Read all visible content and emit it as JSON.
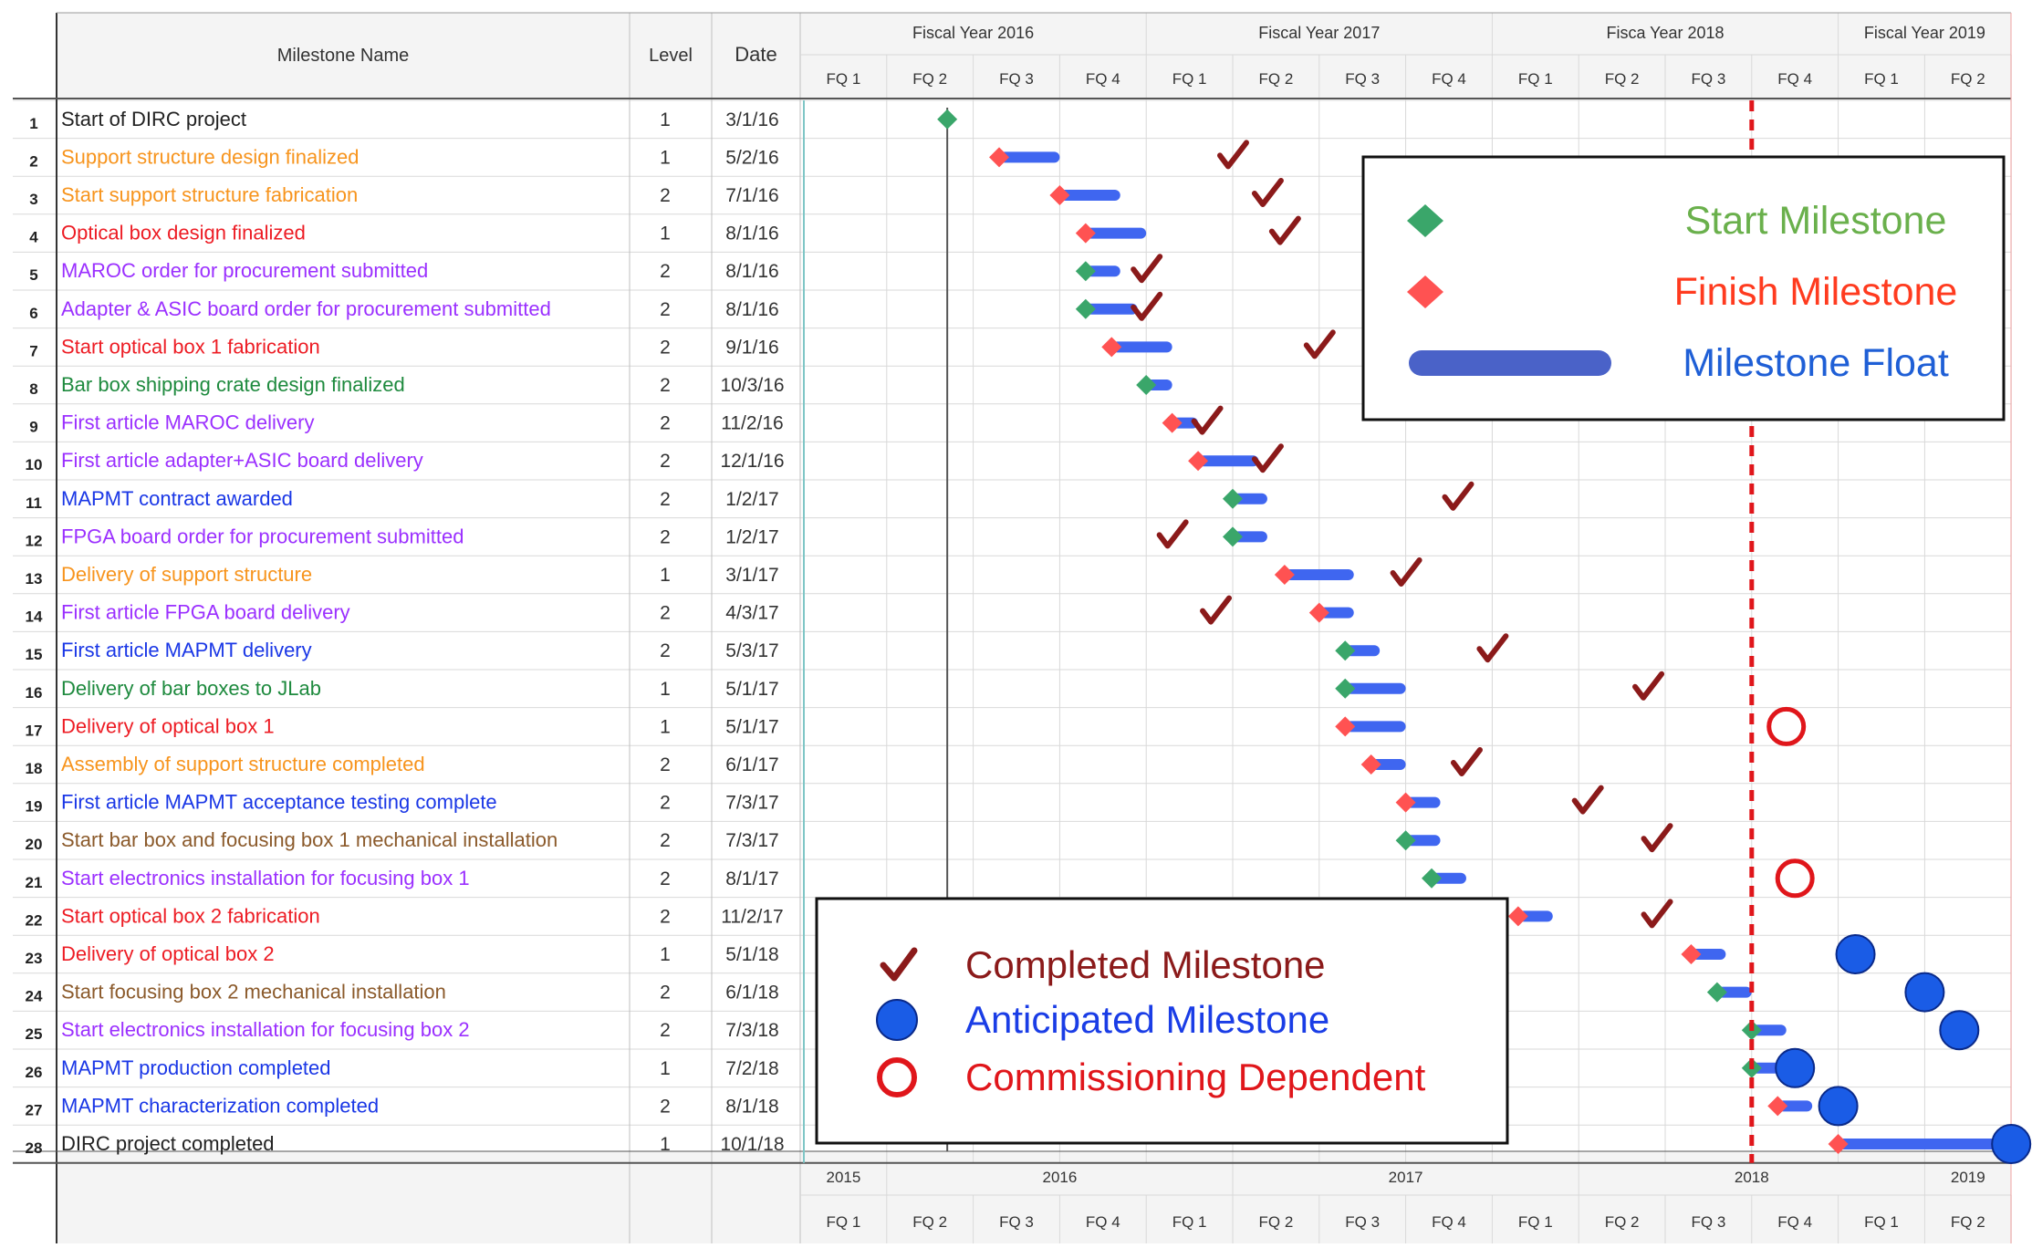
{
  "chart_data": {
    "type": "gantt",
    "columns": {
      "number": "",
      "name": "Milestone Name",
      "level": "Level",
      "date": "Date"
    },
    "fiscal_years": [
      "Fiscal Year 2016",
      "Fiscal Year 2017",
      "Fisca Year 2018",
      "Fiscal Year 2019"
    ],
    "quarters": [
      "FQ 1",
      "FQ 2",
      "FQ 3",
      "FQ 4",
      "FQ 1",
      "FQ 2",
      "FQ 3",
      "FQ 4",
      "FQ 1",
      "FQ 2",
      "FQ 3",
      "FQ 4",
      "FQ 1",
      "FQ 2"
    ],
    "footer_years": [
      "2015",
      "2016",
      "2017",
      "2018",
      "2019"
    ],
    "footer_quarters": [
      "FQ 1",
      "FQ 2",
      "FQ 3",
      "FQ 4",
      "FQ 1",
      "FQ 2",
      "FQ 3",
      "FQ 4",
      "FQ 1",
      "FQ 2",
      "FQ 3",
      "FQ 4",
      "FQ 1",
      "FQ 2"
    ],
    "axis_start_quarter_index": 0,
    "today_line_quarter": 11.0,
    "project_start_line_quarter": 1.7,
    "milestones": [
      {
        "num": "1",
        "name": "Start of DIRC project",
        "level": "1",
        "date": "3/1/16",
        "color": "#222222",
        "start_q": 1.7,
        "float_q": 0.0,
        "status_q": null,
        "status": "none"
      },
      {
        "num": "2",
        "name": "Support structure design finalized",
        "level": "1",
        "date": "5/2/16",
        "color": "#f7941d",
        "start_q": 2.3,
        "float_q": 0.7,
        "status_q": 5.0,
        "status": "completed"
      },
      {
        "num": "3",
        "name": "Start support structure fabrication",
        "level": "2",
        "date": "7/1/16",
        "color": "#f7941d",
        "start_q": 3.0,
        "float_q": 0.7,
        "status_q": 5.4,
        "status": "completed"
      },
      {
        "num": "4",
        "name": "Optical box design finalized",
        "level": "1",
        "date": "8/1/16",
        "color": "#ed1c24",
        "start_q": 3.3,
        "float_q": 0.7,
        "status_q": 5.6,
        "status": "completed"
      },
      {
        "num": "5",
        "name": "MAROC order for procurement submitted",
        "level": "2",
        "date": "8/1/16",
        "color": "#9b30ff",
        "start_q": 3.3,
        "float_q": 0.4,
        "status_q": 4.0,
        "status": "completed"
      },
      {
        "num": "6",
        "name": "Adapter & ASIC board order for procurement submitted",
        "level": "2",
        "date": "8/1/16",
        "color": "#9b30ff",
        "start_q": 3.3,
        "float_q": 0.6,
        "status_q": 4.0,
        "status": "completed"
      },
      {
        "num": "7",
        "name": "Start optical box 1 fabrication",
        "level": "2",
        "date": "9/1/16",
        "color": "#ed1c24",
        "start_q": 3.6,
        "float_q": 0.7,
        "status_q": 6.0,
        "status": "completed"
      },
      {
        "num": "8",
        "name": "Bar box shipping crate design finalized",
        "level": "2",
        "date": "10/3/16",
        "color": "#1e8a3e",
        "start_q": 4.0,
        "float_q": 0.3,
        "status_q": null,
        "status": "none"
      },
      {
        "num": "9",
        "name": "First article MAROC delivery",
        "level": "2",
        "date": "11/2/16",
        "color": "#9b30ff",
        "start_q": 4.3,
        "float_q": 0.3,
        "status_q": 4.7,
        "status": "completed"
      },
      {
        "num": "10",
        "name": "First article adapter+ASIC board delivery",
        "level": "2",
        "date": "12/1/16",
        "color": "#9b30ff",
        "start_q": 4.6,
        "float_q": 0.7,
        "status_q": 5.4,
        "status": "completed"
      },
      {
        "num": "11",
        "name": "MAPMT contract awarded",
        "level": "2",
        "date": "1/2/17",
        "color": "#1a37e6",
        "start_q": 5.0,
        "float_q": 0.4,
        "status_q": 7.6,
        "status": "completed"
      },
      {
        "num": "12",
        "name": "FPGA board order for procurement submitted",
        "level": "2",
        "date": "1/2/17",
        "color": "#9b30ff",
        "start_q": 5.0,
        "float_q": 0.4,
        "status_q": 4.3,
        "status": "completed"
      },
      {
        "num": "13",
        "name": "Delivery of support structure",
        "level": "1",
        "date": "3/1/17",
        "color": "#f7941d",
        "start_q": 5.6,
        "float_q": 0.8,
        "status_q": 7.0,
        "status": "completed"
      },
      {
        "num": "14",
        "name": "First article FPGA board delivery",
        "level": "2",
        "date": "4/3/17",
        "color": "#9b30ff",
        "start_q": 6.0,
        "float_q": 0.4,
        "status_q": 4.8,
        "status": "completed"
      },
      {
        "num": "15",
        "name": "First article MAPMT delivery",
        "level": "2",
        "date": "5/3/17",
        "color": "#1a37e6",
        "start_q": 6.3,
        "float_q": 0.4,
        "status_q": 8.0,
        "status": "completed"
      },
      {
        "num": "16",
        "name": "Delivery of bar boxes to JLab",
        "level": "1",
        "date": "5/1/17",
        "color": "#1e8a3e",
        "start_q": 6.3,
        "float_q": 0.7,
        "status_q": 9.8,
        "status": "completed"
      },
      {
        "num": "17",
        "name": "Delivery of optical box 1",
        "level": "1",
        "date": "5/1/17",
        "color": "#ed1c24",
        "start_q": 6.3,
        "float_q": 0.7,
        "status_q": 11.4,
        "status": "commissioning"
      },
      {
        "num": "18",
        "name": "Assembly of support structure completed",
        "level": "2",
        "date": "6/1/17",
        "color": "#f7941d",
        "start_q": 6.6,
        "float_q": 0.4,
        "status_q": 7.7,
        "status": "completed"
      },
      {
        "num": "19",
        "name": "First article MAPMT acceptance testing complete",
        "level": "2",
        "date": "7/3/17",
        "color": "#1a37e6",
        "start_q": 7.0,
        "float_q": 0.4,
        "status_q": 9.1,
        "status": "completed"
      },
      {
        "num": "20",
        "name": "Start bar box and focusing box 1 mechanical installation",
        "level": "2",
        "date": "7/3/17",
        "color": "#8b5a2b",
        "start_q": 7.0,
        "float_q": 0.4,
        "status_q": 9.9,
        "status": "completed"
      },
      {
        "num": "21",
        "name": "Start electronics installation for focusing box 1",
        "level": "2",
        "date": "8/1/17",
        "color": "#9b30ff",
        "start_q": 7.3,
        "float_q": 0.4,
        "status_q": 11.5,
        "status": "commissioning"
      },
      {
        "num": "22",
        "name": "Start optical box 2 fabrication",
        "level": "2",
        "date": "11/2/17",
        "color": "#ed1c24",
        "start_q": 8.3,
        "float_q": 0.4,
        "status_q": 9.9,
        "status": "completed"
      },
      {
        "num": "23",
        "name": "Delivery of optical box 2",
        "level": "1",
        "date": "5/1/18",
        "color": "#ed1c24",
        "start_q": 10.3,
        "float_q": 0.4,
        "status_q": 12.2,
        "status": "anticipated"
      },
      {
        "num": "24",
        "name": "Start focusing box 2 mechanical installation",
        "level": "2",
        "date": "6/1/18",
        "color": "#8b5a2b",
        "start_q": 10.6,
        "float_q": 0.4,
        "status_q": 13.0,
        "status": "anticipated"
      },
      {
        "num": "25",
        "name": "Start electronics installation for focusing box 2",
        "level": "2",
        "date": "7/3/18",
        "color": "#9b30ff",
        "start_q": 11.0,
        "float_q": 0.4,
        "status_q": 13.4,
        "status": "anticipated"
      },
      {
        "num": "26",
        "name": "MAPMT production completed",
        "level": "1",
        "date": "7/2/18",
        "color": "#1a37e6",
        "start_q": 11.0,
        "float_q": 0.4,
        "status_q": 11.5,
        "status": "anticipated"
      },
      {
        "num": "27",
        "name": "MAPMT characterization completed",
        "level": "2",
        "date": "8/1/18",
        "color": "#1a37e6",
        "start_q": 11.3,
        "float_q": 0.4,
        "status_q": 12.0,
        "status": "anticipated"
      },
      {
        "num": "28",
        "name": "DIRC project completed",
        "level": "1",
        "date": "10/1/18",
        "color": "#222222",
        "start_q": 12.0,
        "float_q": 2.0,
        "status_q": 14.0,
        "status": "anticipated"
      }
    ],
    "legend_top": [
      {
        "label": "Start Milestone",
        "color": "#6ab04c",
        "marker": "diamond-green"
      },
      {
        "label": "Finish Milestone",
        "color": "#ff3b1f",
        "marker": "diamond-red"
      },
      {
        "label": "Milestone Float",
        "color": "#1f5fd6",
        "marker": "float-bar"
      }
    ],
    "legend_bottom": [
      {
        "label": "Completed Milestone",
        "color": "#8b1a1a",
        "marker": "check"
      },
      {
        "label": "Anticipated Milestone",
        "color": "#1a3de6",
        "marker": "blue-circle"
      },
      {
        "label": "Commissioning Dependent",
        "color": "#e0161b",
        "marker": "red-ring"
      }
    ],
    "colors": {
      "grid": "#d9d9d9",
      "header_bg": "#f4f4f4",
      "float_bar": "#3f66f0",
      "start_diamond": "#3aa66a",
      "finish_diamond": "#ff5252",
      "check": "#8b1a1a",
      "anticipated": "#1a5ce6",
      "commissioning": "#e0161b",
      "today_line": "#e0161b"
    }
  }
}
